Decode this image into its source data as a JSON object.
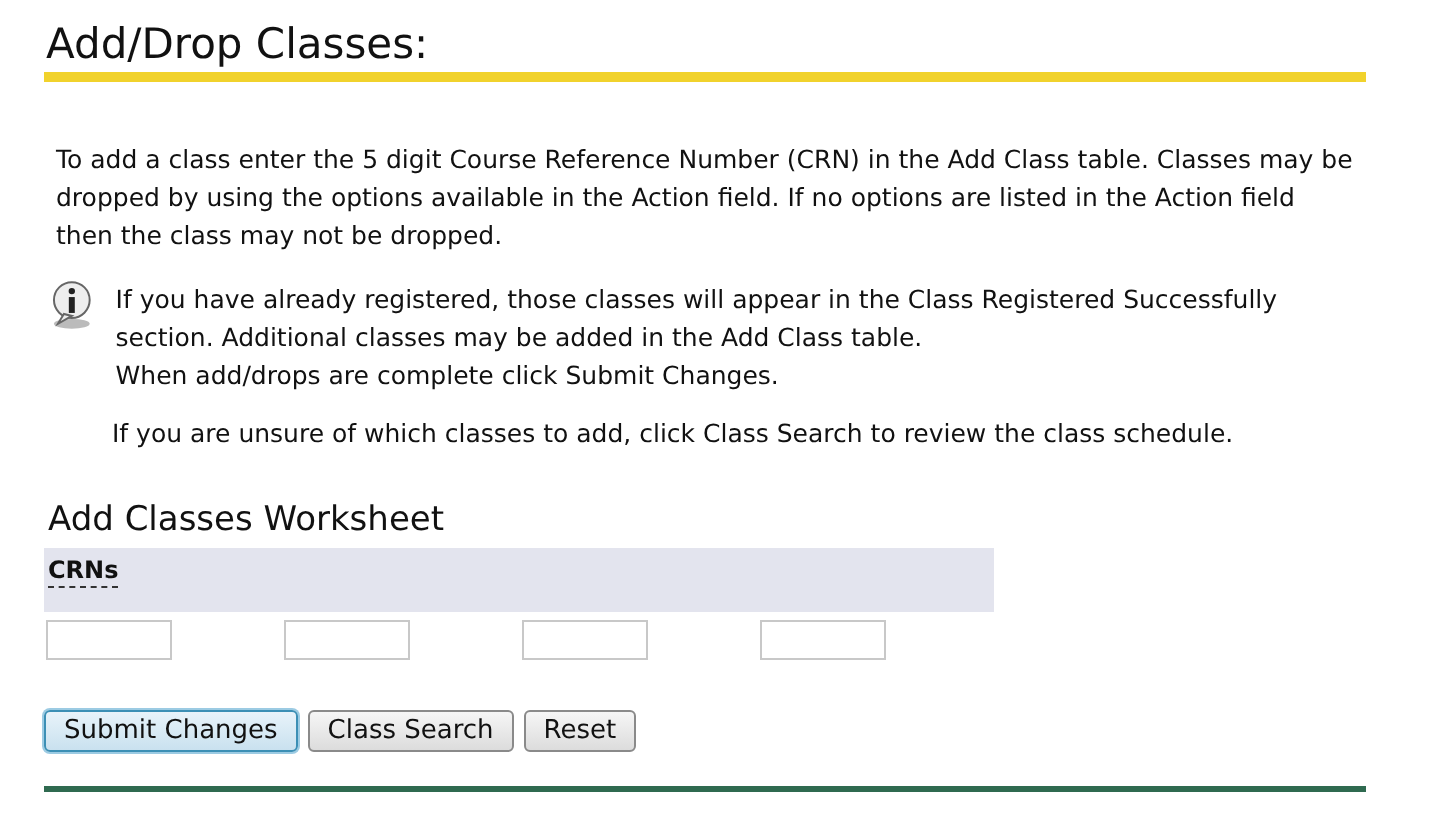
{
  "title": "Add/Drop Classes:",
  "intro": "To add a class enter the 5 digit Course Reference Number (CRN) in the Add Class table. Classes may be dropped by using the options available in the Action field. If no options are listed in the Action field then the class may not be dropped.",
  "note": {
    "lines": [
      "If you have already registered, those classes will appear in the Class Registered Successfully section. Additional classes may be added in the Add Class table.",
      "When add/drops are complete click Submit Changes."
    ]
  },
  "hint": "If you are unsure of which classes to add, click Class Search to review the class schedule.",
  "worksheet": {
    "heading": "Add Classes Worksheet",
    "column": "CRNs",
    "fields": [
      {
        "kind": "text"
      },
      {
        "kind": "text"
      },
      {
        "kind": "text"
      },
      {
        "kind": "text"
      }
    ]
  },
  "buttons": [
    {
      "label": "Submit Changes",
      "focused": true
    },
    {
      "label": "Class Search",
      "focused": false
    },
    {
      "label": "Reset",
      "focused": false
    }
  ]
}
